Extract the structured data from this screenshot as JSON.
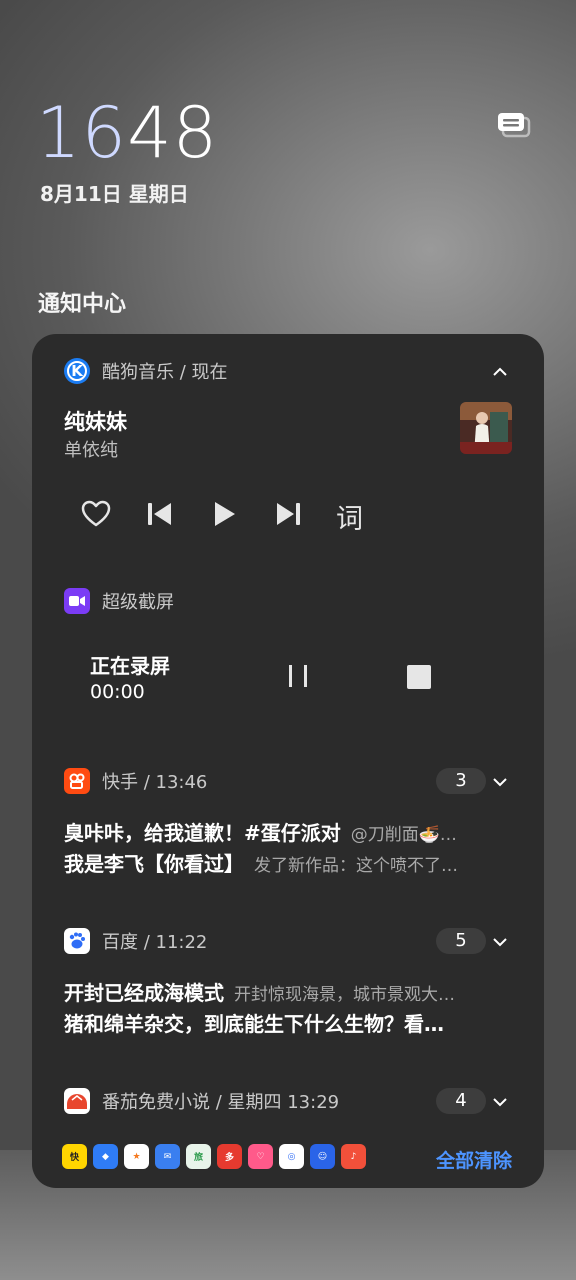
{
  "lockscreen": {
    "clock_hour": "16",
    "clock_minute": "48",
    "date": "8月11日 星期日"
  },
  "notification_center": {
    "title": "通知中心",
    "clear_all": "全部清除"
  },
  "music": {
    "app_meta": "酷狗音乐 / 现在",
    "song_title": "纯妹妹",
    "artist": "单依纯",
    "lyrics_label": "词"
  },
  "recorder": {
    "app_meta": "超级截屏",
    "status": "正在录屏",
    "time": "00:00"
  },
  "notifications": [
    {
      "app_meta": "快手 / 13:46",
      "count": "3",
      "line1_bold": "臭咔咔，给我道歉！#蛋仔派对",
      "line1_gray": "@刀削面🍜…",
      "line2_bold": "我是李飞【你看过】",
      "line2_gray": "发了新作品：这个喷不了…"
    },
    {
      "app_meta": "百度 / 11:22",
      "count": "5",
      "line1_bold": "开封已经成海模式",
      "line1_gray": "开封惊现海景，城市景观大…",
      "line2_bold": "猪和绵羊杂交，到底能生下什么生物？看…",
      "line2_gray": ""
    },
    {
      "app_meta": "番茄免费小说 / 星期四 13:29",
      "count": "4"
    }
  ],
  "icons": {
    "kugou_letter": "K",
    "kuaishou_color": "#ff4b12",
    "baidu_color": "#2f6df6",
    "fanqie_color": "#e8462e",
    "accent": "#4d94ff"
  }
}
